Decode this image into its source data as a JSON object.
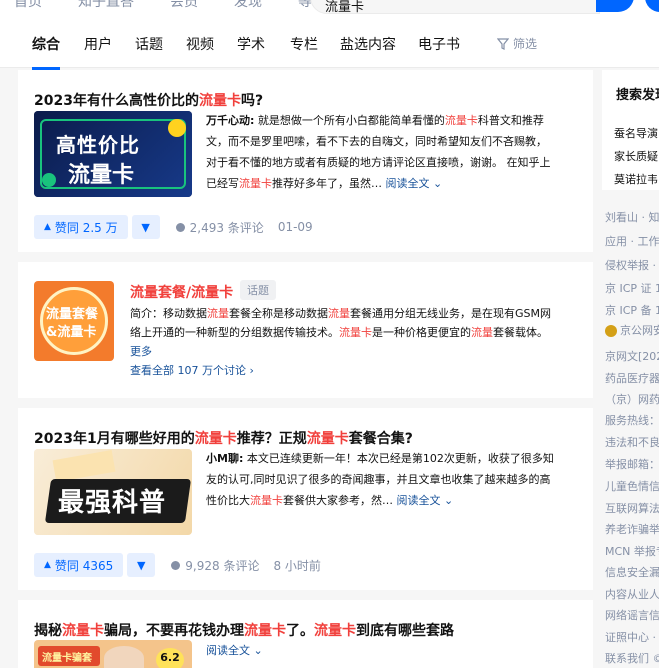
{
  "topnav": [
    "首页",
    "知乎直答",
    "会员",
    "发现",
    "等你来答"
  ],
  "search": {
    "query": "流量卡"
  },
  "tabs": [
    "综合",
    "用户",
    "话题",
    "视频",
    "学术",
    "专栏",
    "盐选内容",
    "电子书"
  ],
  "filter_label": "筛选",
  "cards": [
    {
      "title_pre": "2023年有什么高性价比的",
      "title_hl": "流量卡",
      "title_post": "吗?",
      "thumb_text1": "高性价比",
      "thumb_text2": "流量卡",
      "excerpt_author": "万千心动:",
      "excerpt_l1_pre": " 就是想做一个所有小白都能简单看懂的",
      "excerpt_l1_hl": "流量卡",
      "excerpt_l1_post": "科普文和推荐",
      "excerpt_l2": "文，而不是罗里吧嗦，看不下去的自嗨文，同时希望知友们不吝赐教，",
      "excerpt_l3": "对于看不懂的地方或者有质疑的地方请评论区直接喷，谢谢。 在知乎上",
      "excerpt_l4_pre": "已经写",
      "excerpt_l4_hl": "流量卡",
      "excerpt_l4_post": "推荐好多年了，虽然…",
      "read_more": "阅读全文",
      "vote": "赞同 2.5 万",
      "comments": "2,493 条评论",
      "date": "01-09"
    },
    {
      "title_pre": "2023年1月有哪些好用的",
      "title_hl": "流量卡",
      "title_mid": "推荐？正规",
      "title_hl2": "流量卡",
      "title_post": "套餐合集?",
      "thumb_text": "最强科普",
      "excerpt_author": "小M聊:",
      "excerpt_l1": " 本文已连续更新一年！本次已经是第102次更新，收获了很多知",
      "excerpt_l2": "友的认可,同时见识了很多的奇闻趣事，并且文章也收集了越来越多的高",
      "excerpt_l3_pre": "性价比大",
      "excerpt_l3_hl": "流量卡",
      "excerpt_l3_post": "套餐供大家参考，然…",
      "read_more": "阅读全文",
      "vote": "赞同 4365",
      "comments": "9,928 条评论",
      "date": "8 小时前"
    },
    {
      "title_pre": "揭秘",
      "title_hl": "流量卡",
      "title_mid": "骗局，不要再花钱办理",
      "title_hl2": "流量卡",
      "title_mid2": "了。",
      "title_hl3": "流量卡",
      "title_post": "到底有哪些套路",
      "thumb_text": "流量卡骗套",
      "thumb_badge": "6.2",
      "read_more": "阅读全文"
    }
  ],
  "topic": {
    "img_text1": "流量套餐",
    "img_text2": "&流量卡",
    "name": "流量套餐/流量卡",
    "tag": "话题",
    "desc_label": "简介：",
    "desc_l1_a": "移动数据",
    "desc_l1_hl": "流量",
    "desc_l1_b": "套餐全称是移动数据",
    "desc_l1_hl2": "流量",
    "desc_l1_c": "套餐通用分组无线业务，是在现有GSM网",
    "desc_l2_a": "络上开通的一种新型的分组数据传输技术。",
    "desc_l2_hl": "流量卡",
    "desc_l2_b": "是一种价格更便宜的",
    "desc_l2_hl2": "流量",
    "desc_l2_c": "套餐载体。",
    "more": "更多",
    "link": "查看全部 107 万个讨论"
  },
  "sidebar": {
    "title": "搜索发现",
    "items": [
      "蚕名导演",
      "家长质疑",
      "莫诺拉韦"
    ]
  },
  "footer": [
    "刘看山 · 知乎",
    "应用 · 工作",
    "侵权举报 · 网",
    "京 ICP 证 11",
    "京 ICP 备 13",
    "京公网安",
    "京网文[2022",
    "药品医疗器械",
    "（京）网药",
    "服务热线：",
    "违法和不良",
    "举报邮箱：",
    "儿童色情信",
    "互联网算法",
    "养老诈骗举",
    "MCN 举报专",
    "信息安全漏",
    "内容从业人",
    "网络谣言信",
    "证照中心 ·",
    "联系我们 ©"
  ],
  "colors": {
    "accent": "#0066ff",
    "highlight": "#f1403c",
    "link": "#175199",
    "muted": "#8590a6"
  }
}
